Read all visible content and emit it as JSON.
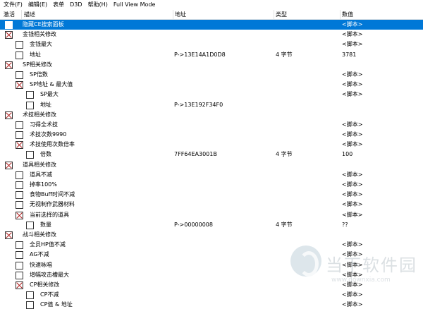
{
  "menubar": {
    "items": [
      "文件(F)",
      "编辑(E)",
      "表单",
      "D3D",
      "帮助(H)",
      "Full View Mode"
    ]
  },
  "columns": {
    "active": "激活",
    "description": "描述",
    "address": "地址",
    "type": "类型",
    "value": "数值"
  },
  "rows": [
    {
      "level": 0,
      "checked": false,
      "selected": true,
      "desc": "隐藏CE搜索面板",
      "addr": "",
      "type": "",
      "value": "<脚本>"
    },
    {
      "level": 0,
      "checked": true,
      "selected": false,
      "desc": "金钱相关修改",
      "addr": "",
      "type": "",
      "value": "<脚本>"
    },
    {
      "level": 1,
      "checked": false,
      "selected": false,
      "desc": "金钱最大",
      "addr": "",
      "type": "",
      "value": "<脚本>"
    },
    {
      "level": 1,
      "checked": false,
      "selected": false,
      "desc": "地址",
      "addr": "P->13E14A1D0D8",
      "type": "4 字节",
      "value": "3781"
    },
    {
      "level": 0,
      "checked": true,
      "selected": false,
      "desc": "SP相关修改",
      "addr": "",
      "type": "",
      "value": ""
    },
    {
      "level": 1,
      "checked": false,
      "selected": false,
      "desc": "SP倍数",
      "addr": "",
      "type": "",
      "value": "<脚本>"
    },
    {
      "level": 1,
      "checked": true,
      "selected": false,
      "desc": "SP地址 & 最大值",
      "addr": "",
      "type": "",
      "value": "<脚本>"
    },
    {
      "level": 2,
      "checked": false,
      "selected": false,
      "desc": "SP最大",
      "addr": "",
      "type": "",
      "value": "<脚本>"
    },
    {
      "level": 2,
      "checked": false,
      "selected": false,
      "desc": "地址",
      "addr": "P->13E192F34F0",
      "type": "",
      "value": ""
    },
    {
      "level": 0,
      "checked": true,
      "selected": false,
      "desc": "术技相关修改",
      "addr": "",
      "type": "",
      "value": ""
    },
    {
      "level": 1,
      "checked": false,
      "selected": false,
      "desc": "习得全术技",
      "addr": "",
      "type": "",
      "value": "<脚本>"
    },
    {
      "level": 1,
      "checked": false,
      "selected": false,
      "desc": "术技次数9990",
      "addr": "",
      "type": "",
      "value": "<脚本>"
    },
    {
      "level": 1,
      "checked": true,
      "selected": false,
      "desc": "术技使用次数倍率",
      "addr": "",
      "type": "",
      "value": "<脚本>"
    },
    {
      "level": 2,
      "checked": false,
      "selected": false,
      "desc": "倍数",
      "addr": "7FF64EA3001B",
      "type": "4 字节",
      "value": "100"
    },
    {
      "level": 0,
      "checked": true,
      "selected": false,
      "desc": "道具相关修改",
      "addr": "",
      "type": "",
      "value": ""
    },
    {
      "level": 1,
      "checked": false,
      "selected": false,
      "desc": "道具不减",
      "addr": "",
      "type": "",
      "value": "<脚本>"
    },
    {
      "level": 1,
      "checked": false,
      "selected": false,
      "desc": "掉率100%",
      "addr": "",
      "type": "",
      "value": "<脚本>"
    },
    {
      "level": 1,
      "checked": false,
      "selected": false,
      "desc": "食物Buff时间不减",
      "addr": "",
      "type": "",
      "value": "<脚本>"
    },
    {
      "level": 1,
      "checked": false,
      "selected": false,
      "desc": "无视制作武器材料",
      "addr": "",
      "type": "",
      "value": "<脚本>"
    },
    {
      "level": 1,
      "checked": true,
      "selected": false,
      "desc": "当前选择的道具",
      "addr": "",
      "type": "",
      "value": "<脚本>"
    },
    {
      "level": 2,
      "checked": false,
      "selected": false,
      "desc": "数量",
      "addr": "P->00000008",
      "type": "4 字节",
      "value": "??"
    },
    {
      "level": 0,
      "checked": true,
      "selected": false,
      "desc": "战斗相关修改",
      "addr": "",
      "type": "",
      "value": ""
    },
    {
      "level": 1,
      "checked": false,
      "selected": false,
      "desc": "全员HP值不减",
      "addr": "",
      "type": "",
      "value": "<脚本>"
    },
    {
      "level": 1,
      "checked": false,
      "selected": false,
      "desc": "AG不减",
      "addr": "",
      "type": "",
      "value": "<脚本>"
    },
    {
      "level": 1,
      "checked": false,
      "selected": false,
      "desc": "快速咏唱",
      "addr": "",
      "type": "",
      "value": "<脚本>"
    },
    {
      "level": 1,
      "checked": false,
      "selected": false,
      "desc": "增幅攻击槽最大",
      "addr": "",
      "type": "",
      "value": "<脚本>"
    },
    {
      "level": 1,
      "checked": true,
      "selected": false,
      "desc": "CP相关修改",
      "addr": "",
      "type": "",
      "value": "<脚本>"
    },
    {
      "level": 2,
      "checked": false,
      "selected": false,
      "desc": "CP不减",
      "addr": "",
      "type": "",
      "value": "<脚本>"
    },
    {
      "level": 2,
      "checked": false,
      "selected": false,
      "desc": "CP值 & 地址",
      "addr": "",
      "type": "",
      "value": "<脚本>"
    }
  ],
  "watermark": {
    "title": "当下软件园",
    "url": "www.downxia.com"
  }
}
